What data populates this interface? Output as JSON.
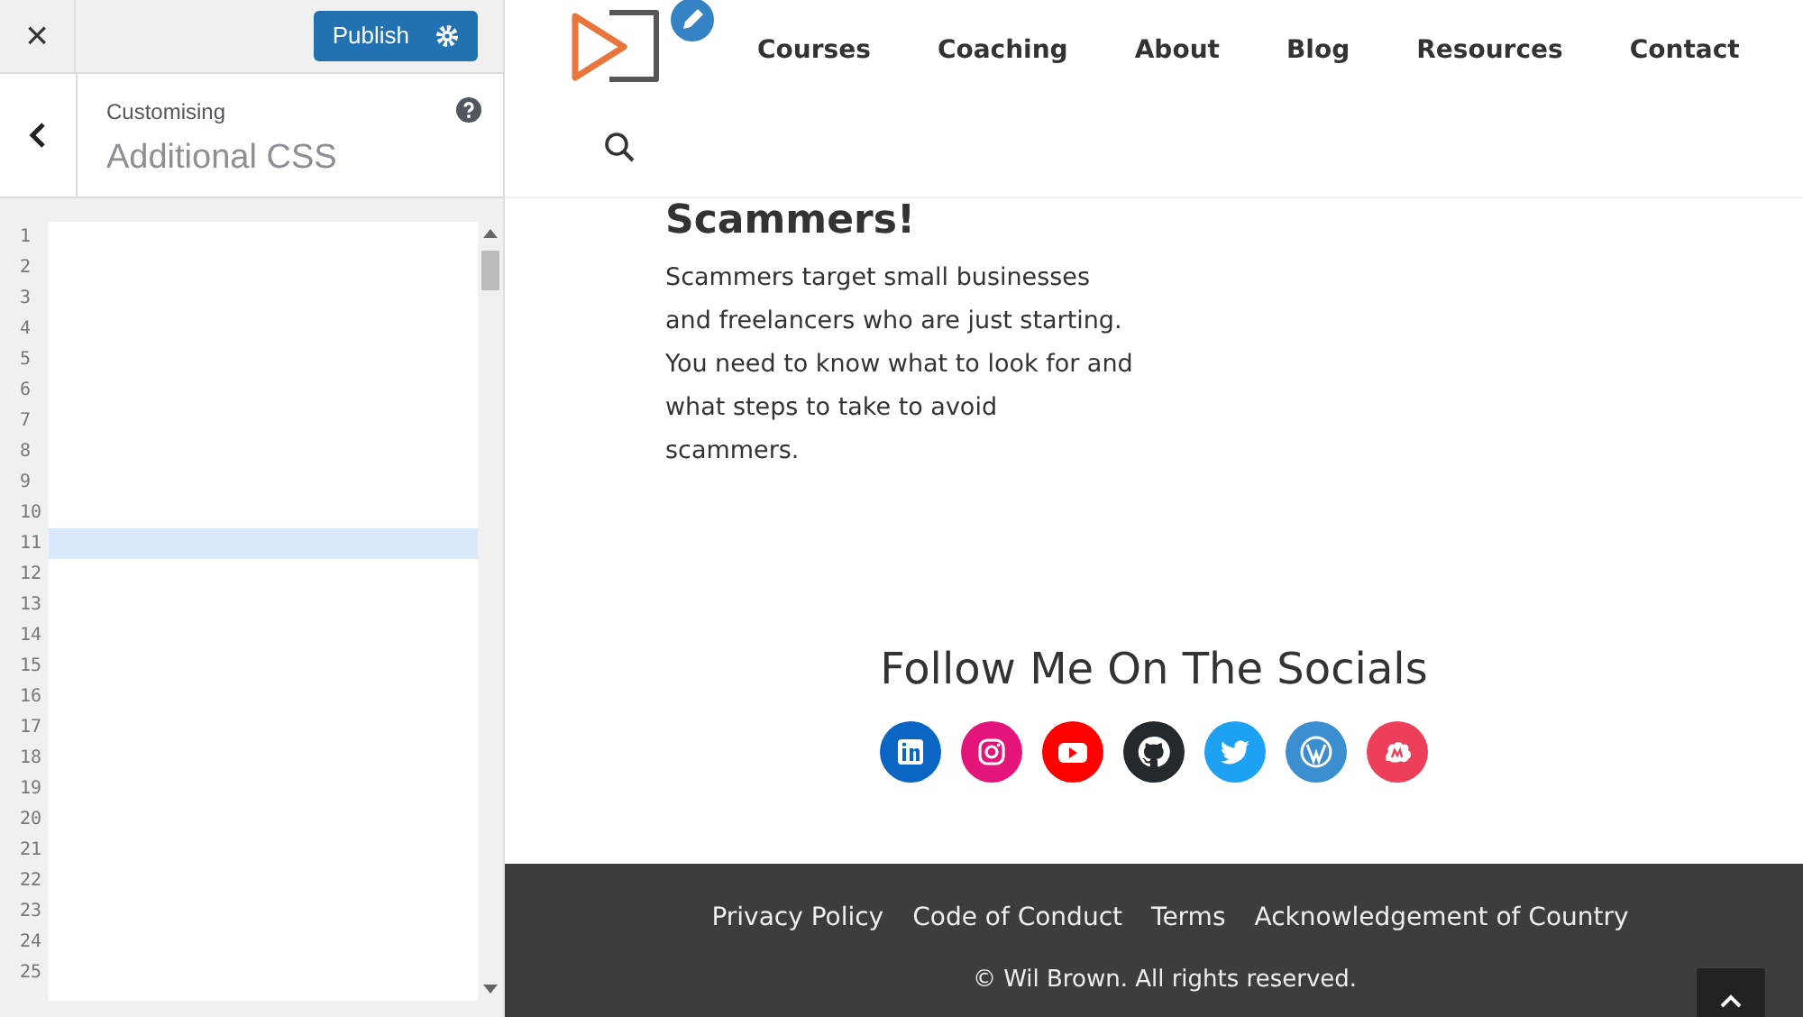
{
  "customizer": {
    "close": "×",
    "publish": "Publish",
    "breadcrumb": "Customising",
    "title": "Additional CSS",
    "editor_lines": [
      {
        "number": "1",
        "active": false
      },
      {
        "number": "2",
        "active": false
      },
      {
        "number": "3",
        "active": false
      },
      {
        "number": "4",
        "active": false
      },
      {
        "number": "5",
        "active": false
      },
      {
        "number": "6",
        "active": false
      },
      {
        "number": "7",
        "active": false
      },
      {
        "number": "8",
        "active": false
      },
      {
        "number": "9",
        "active": false
      },
      {
        "number": "10",
        "active": false
      },
      {
        "number": "11",
        "active": true
      },
      {
        "number": "12",
        "active": false
      },
      {
        "number": "13",
        "active": false
      },
      {
        "number": "14",
        "active": false
      },
      {
        "number": "15",
        "active": false
      },
      {
        "number": "16",
        "active": false
      },
      {
        "number": "17",
        "active": false
      },
      {
        "number": "18",
        "active": false
      },
      {
        "number": "19",
        "active": false
      },
      {
        "number": "20",
        "active": false
      },
      {
        "number": "21",
        "active": false
      },
      {
        "number": "22",
        "active": false
      },
      {
        "number": "23",
        "active": false
      },
      {
        "number": "24",
        "active": false
      },
      {
        "number": "25",
        "active": false
      }
    ]
  },
  "preview": {
    "nav": [
      "Courses",
      "Coaching",
      "About",
      "Blog",
      "Resources",
      "Contact"
    ],
    "article": {
      "heading": "Scammers!",
      "text": "Scammers target small businesses and freelancers who are just starting. You need to know what to look for and what steps to take to avoid scammers."
    },
    "socials": {
      "heading": "Follow Me On The Socials",
      "items": [
        {
          "kind": "linkedin",
          "color": "#0a66c2"
        },
        {
          "kind": "instagram",
          "color": "#e4157a"
        },
        {
          "kind": "youtube",
          "color": "#ff0000"
        },
        {
          "kind": "github",
          "color": "#24292e"
        },
        {
          "kind": "twitter",
          "color": "#1da1f2"
        },
        {
          "kind": "wordpress",
          "color": "#3b8fd0"
        },
        {
          "kind": "meetup",
          "color": "#ed3f5a"
        }
      ]
    },
    "footer": {
      "links": [
        "Privacy Policy",
        "Code of Conduct",
        "Terms",
        "Acknowledgement of Country"
      ],
      "copyright": "© Wil Brown. All rights reserved."
    }
  }
}
